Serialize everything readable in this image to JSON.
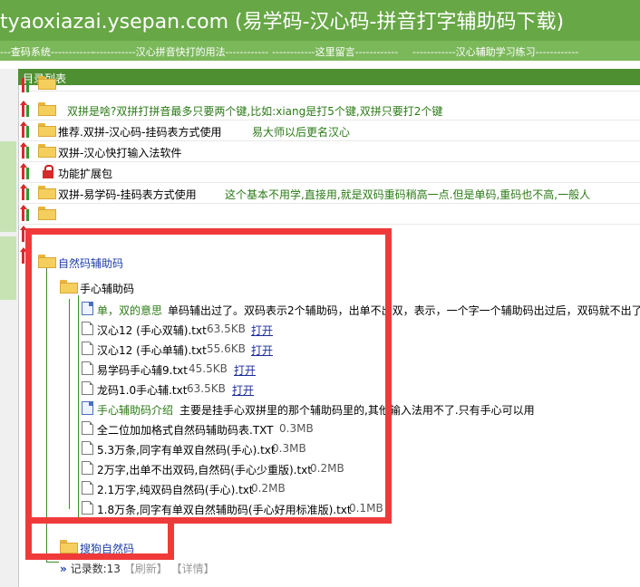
{
  "header": {
    "title": "tyaoxiazai.ysepan.com (易学码-汉心码-拼音打字辅助码下载)"
  },
  "nav": [
    "---查码系统------------",
    "------------汉心拼音快打的用法------------",
    "------------这里留言------------",
    "------------汉心辅助学习练习------------"
  ],
  "panel": {
    "title": "目录列表"
  },
  "rows": [
    {
      "title": "",
      "desc": ""
    },
    {
      "title": "双拼是啥?双拼打拼音最多只要两个键,比如:xiang是打5个键,双拼只要打2个键",
      "desc": ""
    },
    {
      "title": "推荐.双拼-汉心码-挂码表方式使用",
      "desc": "易大师以后更名汉心"
    },
    {
      "title": "双拼-汉心快打输入法软件",
      "desc": ""
    },
    {
      "title": "功能扩展包",
      "desc": ""
    },
    {
      "title": "双拼-易学码-挂码表方式使用",
      "desc": "这个基本不用学,直接用,就是双码重码稍高一点.但是单码,重码也不高,一般人"
    },
    {
      "title": "",
      "desc": ""
    }
  ],
  "section": {
    "folder": "自然码辅助码",
    "subfolder": "手心辅助码",
    "items": [
      {
        "kind": "note",
        "name": "单，双的意思",
        "desc": "单码辅出过了。双码表示2个辅助码，出单不出双，表示，一个字一个辅助码出过后，双码就不出了",
        "size": "",
        "action": ""
      },
      {
        "kind": "file",
        "name": "汉心12 (手心双辅).txt",
        "desc": "",
        "size": "63.5KB",
        "action": "打开"
      },
      {
        "kind": "file",
        "name": "汉心12 (手心单辅).txt",
        "desc": "",
        "size": "55.6KB",
        "action": "打开"
      },
      {
        "kind": "file",
        "name": "易学码手心辅9.txt",
        "desc": "",
        "size": "45.5KB",
        "action": "打开"
      },
      {
        "kind": "file",
        "name": "龙码1.0手心辅.txt",
        "desc": "",
        "size": "63.5KB",
        "action": "打开"
      },
      {
        "kind": "note",
        "name": "手心辅助码介绍",
        "desc": "主要是挂手心双拼里的那个辅助码里的,其他输入法用不了.只有手心可以用",
        "size": "",
        "action": ""
      },
      {
        "kind": "file",
        "name": "全二位加加格式自然码辅助码表.TXT",
        "desc": "",
        "size": "0.3MB",
        "action": ""
      },
      {
        "kind": "file",
        "name": "5.3万条,同字有单双自然码(手心).txt",
        "desc": "",
        "size": "0.3MB",
        "action": ""
      },
      {
        "kind": "file",
        "name": "2万字,出单不出双码,自然码(手心少重版).txt",
        "desc": "",
        "size": "0.2MB",
        "action": ""
      },
      {
        "kind": "file",
        "name": "2.1万字,纯双码自然码(手心).txt",
        "desc": "",
        "size": "0.2MB",
        "action": ""
      },
      {
        "kind": "file",
        "name": "1.8万条,同字有单双自然辅助码(手心好用标准版).txt",
        "desc": "",
        "size": "0.1MB",
        "action": ""
      }
    ],
    "folder2": "搜狗自然码"
  },
  "footer": {
    "chev": "»",
    "label": "记录数:13",
    "refresh": "【刷新】",
    "detail": "【详情】"
  },
  "colors": {
    "header": "#67a746",
    "nav": "#7bb85a",
    "panel": "#4e8f32",
    "highlight": "#f03a3a"
  }
}
